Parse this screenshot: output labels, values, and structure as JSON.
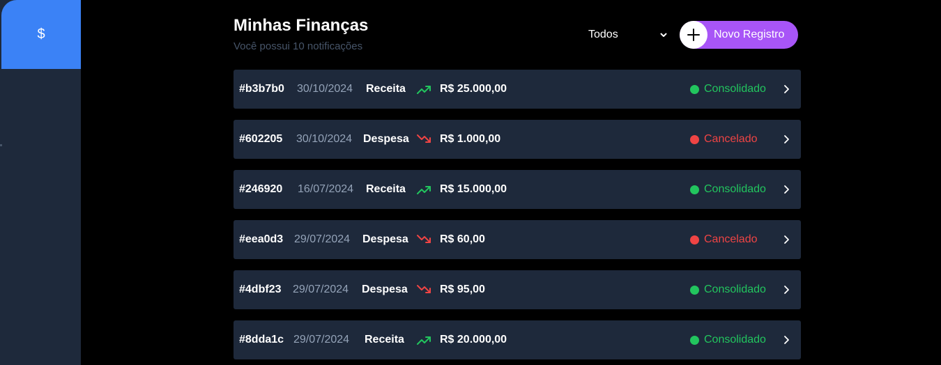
{
  "sidebar": {
    "active_icon": "dollar-icon",
    "active_symbol": "$"
  },
  "header": {
    "title": "Minhas Finanças",
    "subtitle": "Você possui 10 notificações",
    "filter_value": "Todos",
    "new_button_label": "Novo Registro"
  },
  "colors": {
    "background": "#000000",
    "card": "#1e293b",
    "sidebar_active": "#3b82f6",
    "accent": "#a855f7",
    "income": "#22c55e",
    "expense": "#ef4444",
    "muted": "#94a3b8"
  },
  "records": [
    {
      "id": "#b3b7b0",
      "date": "30/10/2024",
      "type": "Receita",
      "trend_icon": "trending-up-icon",
      "amount": "R$ 25.000,00",
      "status": "Consolidado"
    },
    {
      "id": "#602205",
      "date": "30/10/2024",
      "type": "Despesa",
      "trend_icon": "trending-down-icon",
      "amount": "R$ 1.000,00",
      "status": "Cancelado"
    },
    {
      "id": "#246920",
      "date": "16/07/2024",
      "type": "Receita",
      "trend_icon": "trending-up-icon",
      "amount": "R$ 15.000,00",
      "status": "Consolidado"
    },
    {
      "id": "#eea0d3",
      "date": "29/07/2024",
      "type": "Despesa",
      "trend_icon": "trending-down-icon",
      "amount": "R$ 60,00",
      "status": "Cancelado"
    },
    {
      "id": "#4dbf23",
      "date": "29/07/2024",
      "type": "Despesa",
      "trend_icon": "trending-down-icon",
      "amount": "R$ 95,00",
      "status": "Consolidado"
    },
    {
      "id": "#8dda1c",
      "date": "29/07/2024",
      "type": "Receita",
      "trend_icon": "trending-up-icon",
      "amount": "R$ 20.000,00",
      "status": "Consolidado"
    }
  ]
}
